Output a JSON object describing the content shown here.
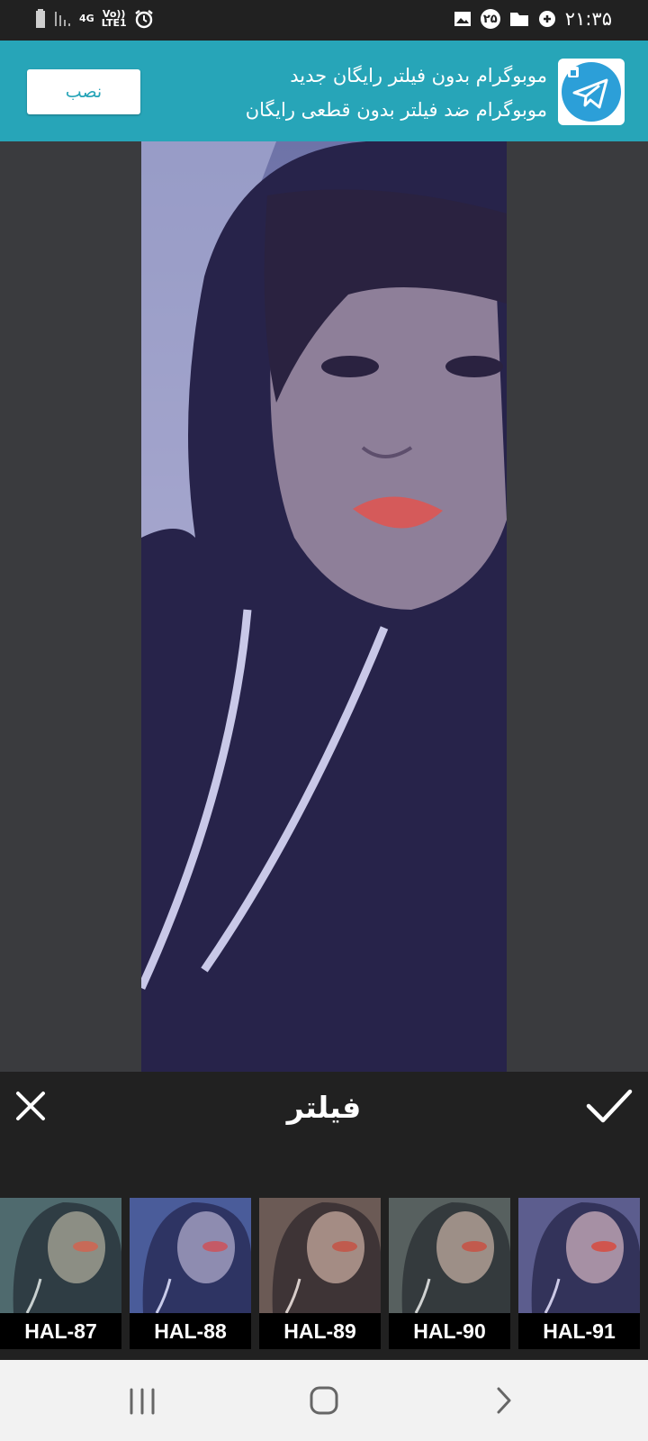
{
  "status_bar": {
    "network": "4G",
    "volte": "Vo)) LTE1",
    "notification_count": "۲۵",
    "time": "۲۱:۳۵"
  },
  "ad": {
    "line1": "موبوگرام بدون فیلتر رایگان جدید",
    "line2": "موبوگرام ضد فیلتر بدون قطعی رایگان",
    "install_label": "نصب",
    "icon": "telegram-plane-icon"
  },
  "editor": {
    "title": "فیلتر",
    "close_icon": "close-icon",
    "confirm_icon": "check-icon"
  },
  "filters": [
    {
      "label": "HAL-87",
      "tint": "#4f6a6e"
    },
    {
      "label": "HAL-88",
      "tint": "#4a5c9a"
    },
    {
      "label": "HAL-89",
      "tint": "#6b5a55"
    },
    {
      "label": "HAL-90",
      "tint": "#57605f"
    },
    {
      "label": "HAL-91",
      "tint": "#5c5d8e"
    }
  ],
  "nav": {
    "recents_icon": "recents-icon",
    "home_icon": "home-icon",
    "back_icon": "back-icon"
  }
}
